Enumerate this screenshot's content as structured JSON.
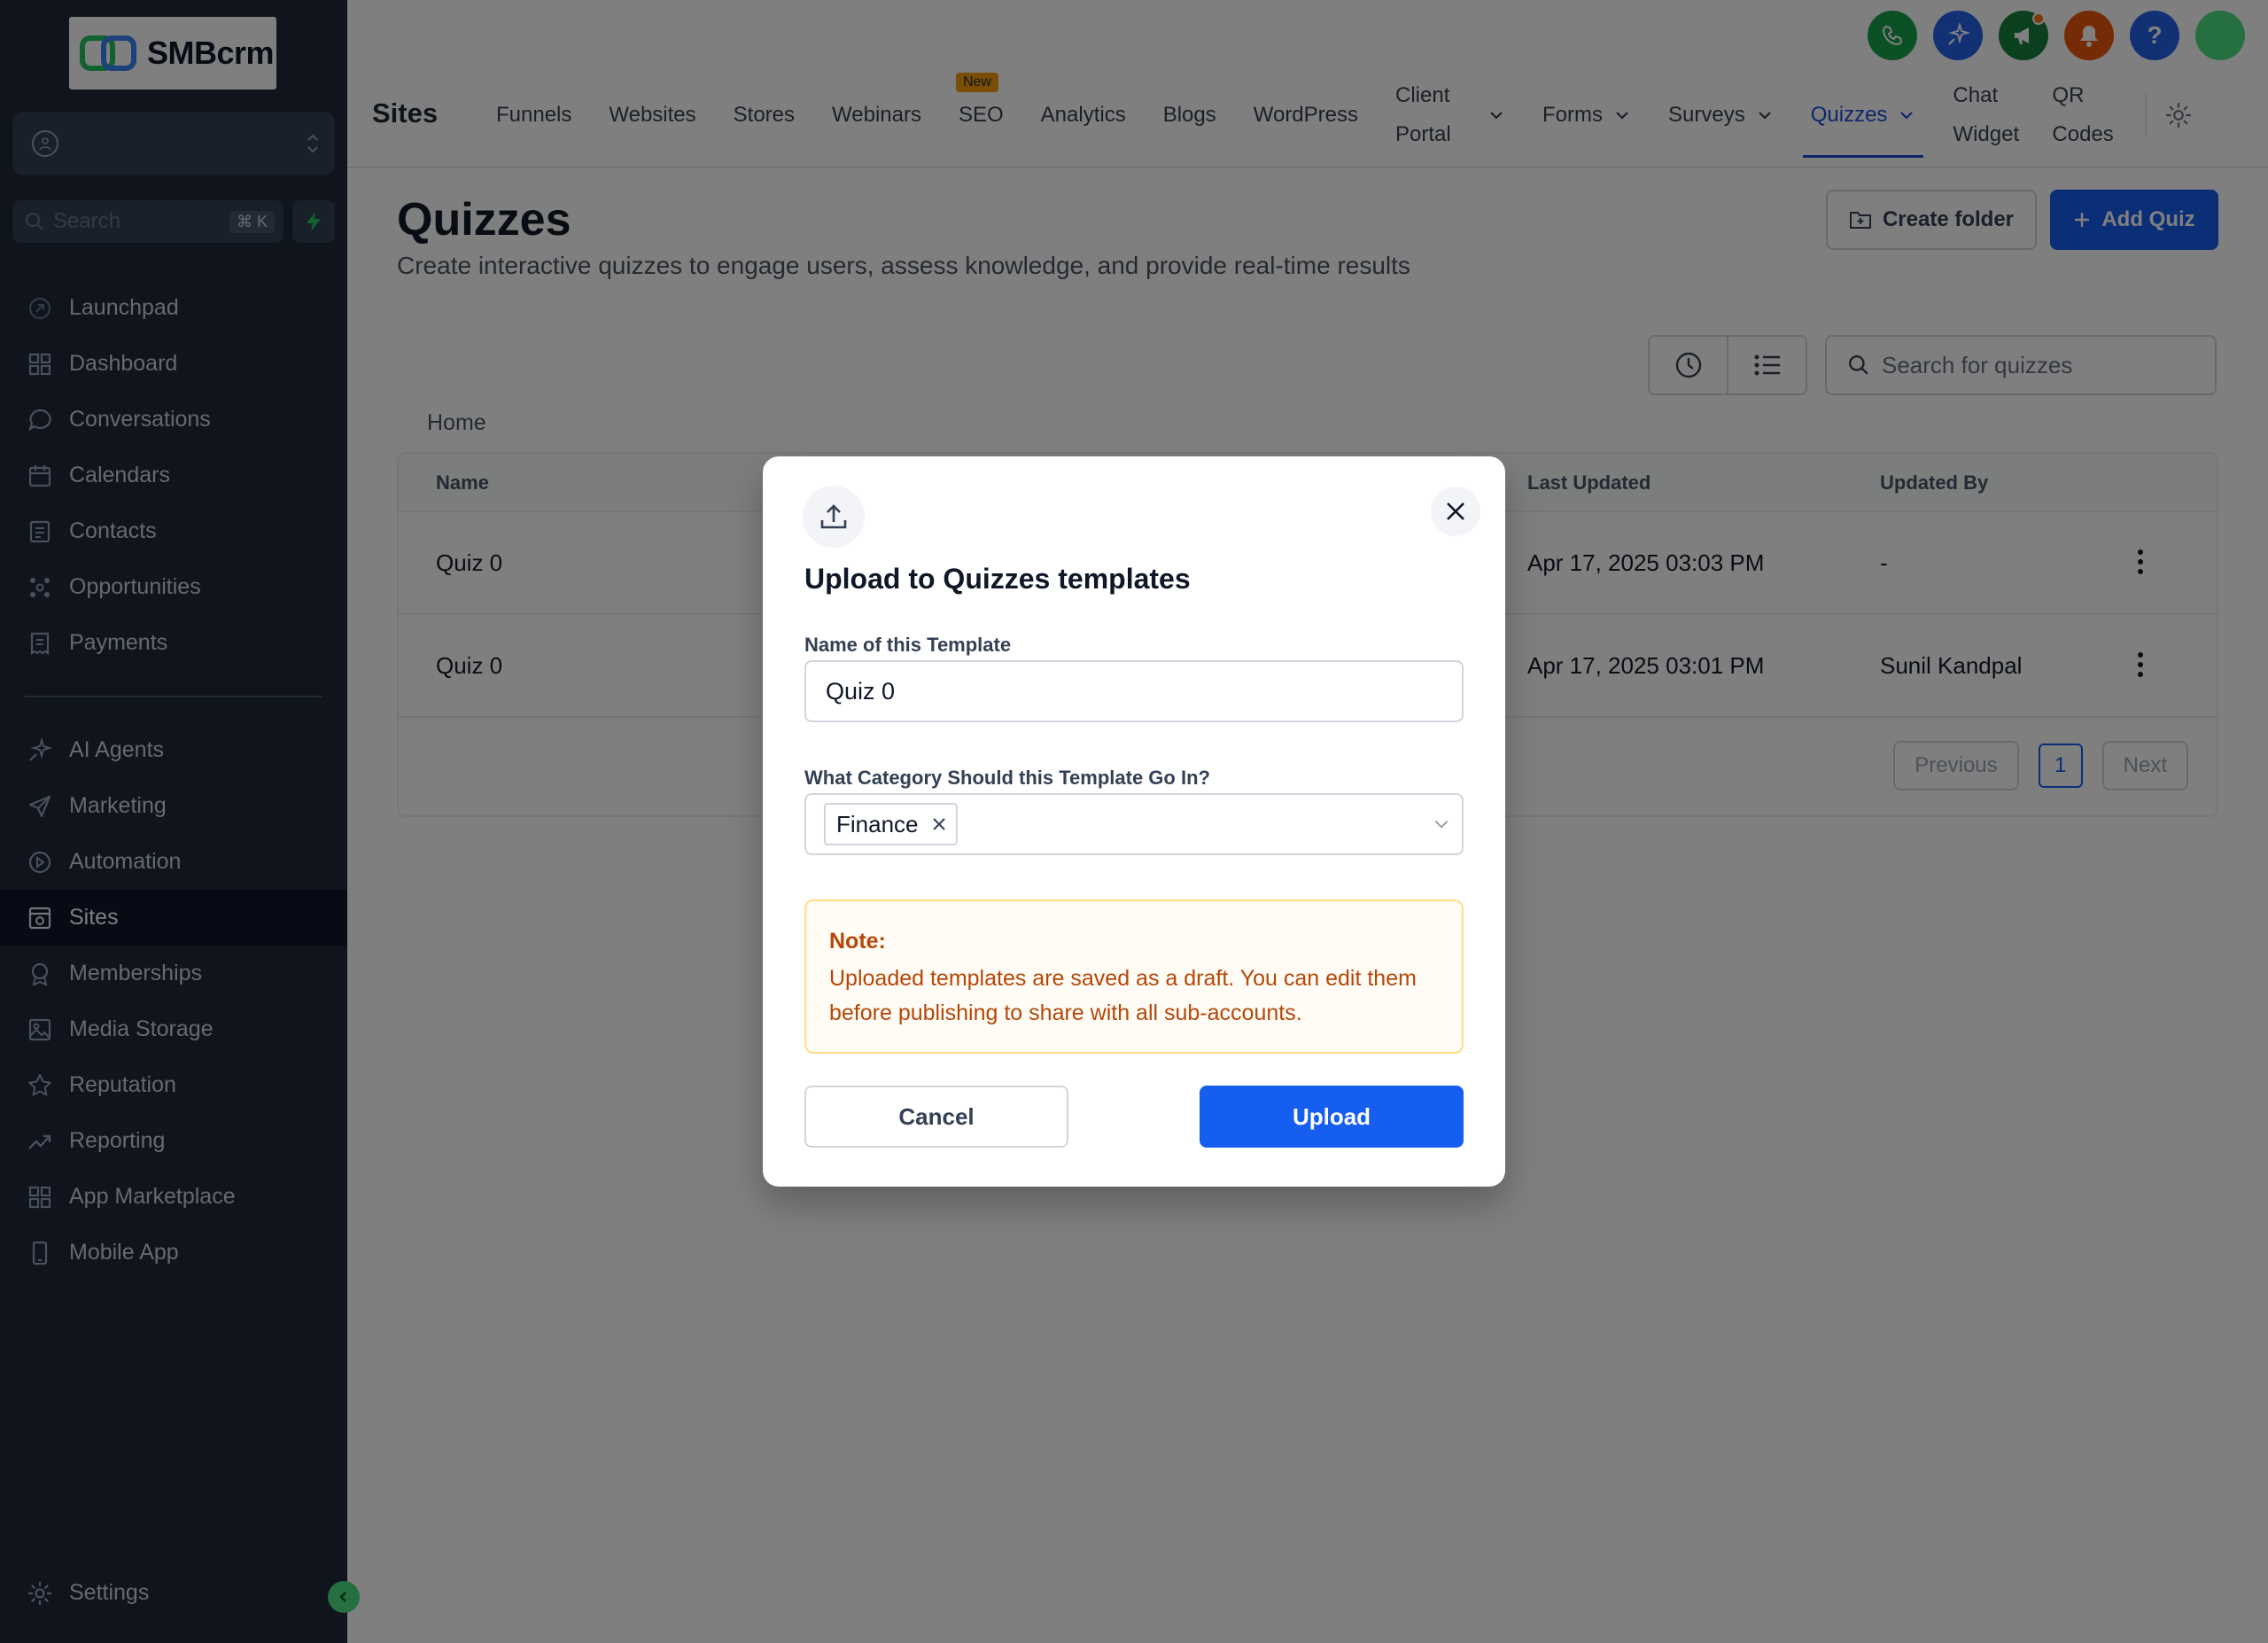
{
  "brand": {
    "logo_text": "SMBcrm"
  },
  "sidebar": {
    "search_placeholder": "Search",
    "search_shortcut": "⌘ K",
    "items_top": [
      {
        "label": "Launchpad",
        "icon": "launchpad-icon"
      },
      {
        "label": "Dashboard",
        "icon": "dashboard-icon"
      },
      {
        "label": "Conversations",
        "icon": "chat-icon"
      },
      {
        "label": "Calendars",
        "icon": "calendar-icon"
      },
      {
        "label": "Contacts",
        "icon": "contacts-icon"
      },
      {
        "label": "Opportunities",
        "icon": "opportunities-icon"
      },
      {
        "label": "Payments",
        "icon": "payments-icon"
      }
    ],
    "items_bottom": [
      {
        "label": "AI Agents",
        "icon": "sparkle-icon"
      },
      {
        "label": "Marketing",
        "icon": "send-icon"
      },
      {
        "label": "Automation",
        "icon": "automation-icon"
      },
      {
        "label": "Sites",
        "icon": "sites-icon",
        "active": true
      },
      {
        "label": "Memberships",
        "icon": "badge-icon"
      },
      {
        "label": "Media Storage",
        "icon": "image-icon"
      },
      {
        "label": "Reputation",
        "icon": "star-icon"
      },
      {
        "label": "Reporting",
        "icon": "trend-icon"
      },
      {
        "label": "App Marketplace",
        "icon": "grid-icon"
      },
      {
        "label": "Mobile App",
        "icon": "mobile-icon"
      }
    ],
    "settings_label": "Settings"
  },
  "header": {
    "section_title": "Sites",
    "tabs": {
      "funnels": "Funnels",
      "websites": "Websites",
      "stores": "Stores",
      "webinars": "Webinars",
      "seo": "SEO",
      "seo_badge": "New",
      "analytics": "Analytics",
      "blogs": "Blogs",
      "wordpress": "WordPress",
      "client_portal": "Client Portal",
      "forms": "Forms",
      "surveys": "Surveys",
      "quizzes": "Quizzes",
      "chat_widget": "Chat Widget",
      "qr_codes": "QR Codes"
    },
    "icon_colors": {
      "phone": "#16a34a",
      "ai": "#2563eb",
      "announce": "#15803d",
      "bell": "#ea580c",
      "help": "#2563eb"
    }
  },
  "main": {
    "title": "Quizzes",
    "subtitle": "Create interactive quizzes to engage users, assess knowledge, and provide real-time results",
    "create_folder_label": "Create folder",
    "add_quiz_label": "Add Quiz",
    "search_placeholder": "Search for quizzes",
    "breadcrumb": "Home",
    "table": {
      "columns": {
        "name": "Name",
        "last_updated": "Last Updated",
        "updated_by": "Updated By"
      },
      "rows": [
        {
          "name": "Quiz 0",
          "last_updated": "Apr 17, 2025 03:03 PM",
          "updated_by": "-"
        },
        {
          "name": "Quiz 0",
          "last_updated": "Apr 17, 2025 03:01 PM",
          "updated_by": "Sunil Kandpal"
        }
      ]
    },
    "pagination": {
      "previous": "Previous",
      "page": "1",
      "next": "Next"
    }
  },
  "modal": {
    "title": "Upload to Quizzes templates",
    "name_label": "Name of this Template",
    "name_value": "Quiz 0",
    "category_label": "What Category Should this Template Go In?",
    "category_chip": "Finance",
    "note_title": "Note:",
    "note_text": "Uploaded templates are saved as a draft. You can edit them before publishing to share with all sub-accounts.",
    "cancel_label": "Cancel",
    "upload_label": "Upload"
  }
}
